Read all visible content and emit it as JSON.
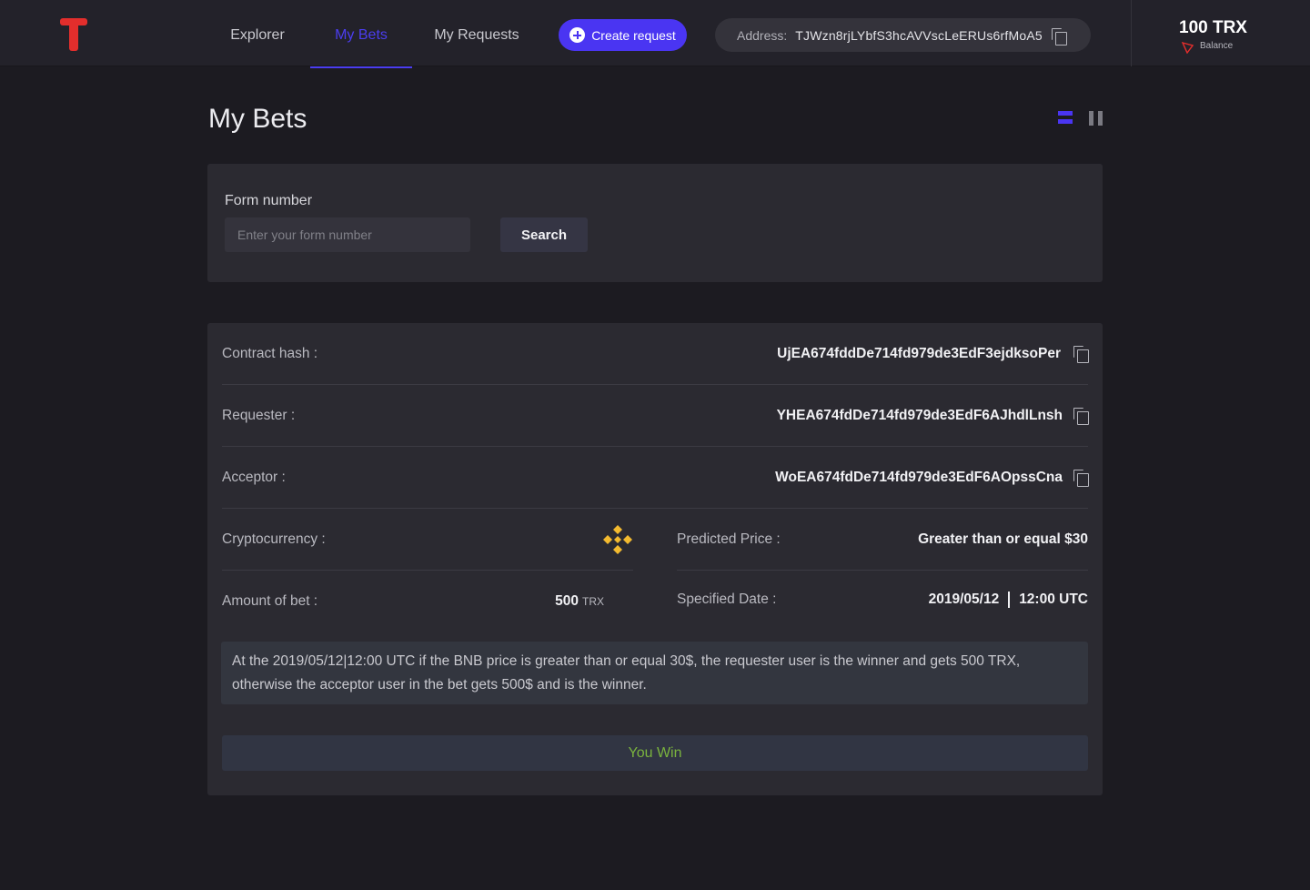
{
  "nav": {
    "items": [
      {
        "label": "Explorer"
      },
      {
        "label": "My Bets"
      },
      {
        "label": "My Requests"
      }
    ],
    "create_label": "Create request",
    "address_label": "Address:",
    "address_value": "TJWzn8rjLYbfS3hcAVVscLeERUs6rfMoA5"
  },
  "balance": {
    "amount": "100 TRX",
    "label": "Balance"
  },
  "page": {
    "title": "My Bets"
  },
  "search": {
    "label": "Form number",
    "placeholder": "Enter your form number",
    "button_label": "Search"
  },
  "details": {
    "contract_hash_label": "Contract hash :",
    "contract_hash": "UjEA674fddDe714fd979de3EdF3ejdksoPer",
    "requester_label": "Requester :",
    "requester": "YHEA674fdDe714fd979de3EdF6AJhdlLnsh",
    "acceptor_label": "Acceptor :",
    "acceptor": "WoEA674fdDe714fd979de3EdF6AOpssCna",
    "cryptocurrency_label": "Cryptocurrency :",
    "cryptocurrency_icon": "bnb-icon",
    "predicted_price_label": "Predicted Price :",
    "predicted_price": "Greater than or equal $30",
    "amount_label": "Amount of bet :",
    "amount_value": "500",
    "amount_unit": "TRX",
    "specified_date_label": "Specified Date :",
    "specified_date": "2019/05/12",
    "specified_time": "12:00 UTC"
  },
  "description": "At the 2019/05/12|12:00 UTC  if the  BNB price is greater than or equal 30$, the requester user is the winner and gets 500 TRX, otherwise the acceptor user in the bet gets 500$ and  is the winner.",
  "result": "You Win",
  "colors": {
    "accent": "#4a35f2",
    "background": "#1c1b21",
    "panel": "#2b2a31",
    "win": "#7ab33e",
    "logo": "#e32e2c",
    "bnb": "#f3ba2f"
  }
}
